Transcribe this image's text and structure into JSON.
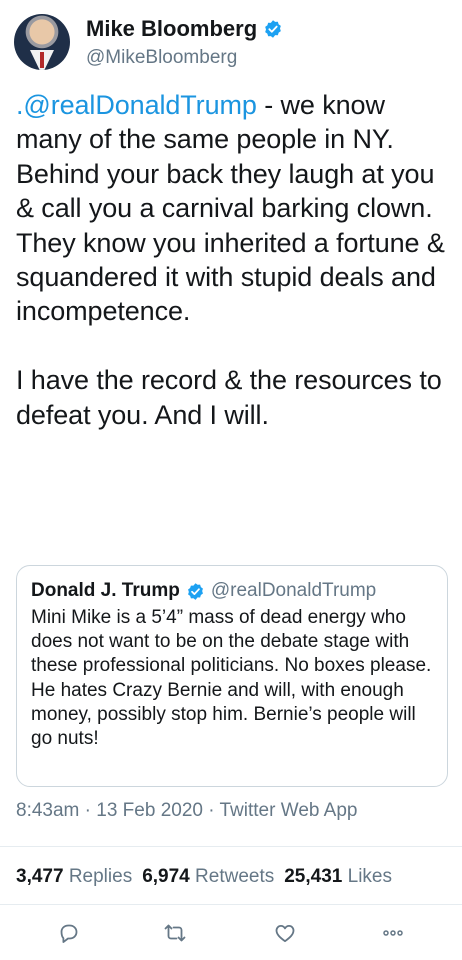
{
  "author": {
    "name": "Mike Bloomberg",
    "handle": "@MikeBloomberg"
  },
  "tweet": {
    "mention": ".@realDonaldTrump",
    "body": " - we know many of the same people in NY. Behind your back they laugh at you & call you a carnival barking clown. They know you inherited a fortune & squandered it with stupid deals and incompetence.\n\nI have the record & the resources to defeat you. And I will."
  },
  "quote": {
    "name": "Donald J. Trump",
    "handle": "@realDonaldTrump",
    "text": "Mini Mike is a 5’4” mass of dead energy who does not want to be on the debate stage with these professional politicians. No boxes please. He hates Crazy Bernie and will, with enough money, possibly stop him. Bernie’s people will go nuts!"
  },
  "meta": {
    "timestamp": "8:43am · 13 Feb 2020 · Twitter Web App"
  },
  "stats": {
    "replies_count": "3,477",
    "replies_label": "Replies",
    "retweets_count": "6,974",
    "retweets_label": "Retweets",
    "likes_count": "25,431",
    "likes_label": "Likes"
  },
  "colors": {
    "verified": "#1da1f2",
    "mention": "#1b95e0",
    "secondary_text": "#657786",
    "action_icon": "#657786"
  },
  "icons": [
    "verified-badge-icon",
    "reply-icon",
    "retweet-icon",
    "like-icon",
    "more-icon"
  ]
}
